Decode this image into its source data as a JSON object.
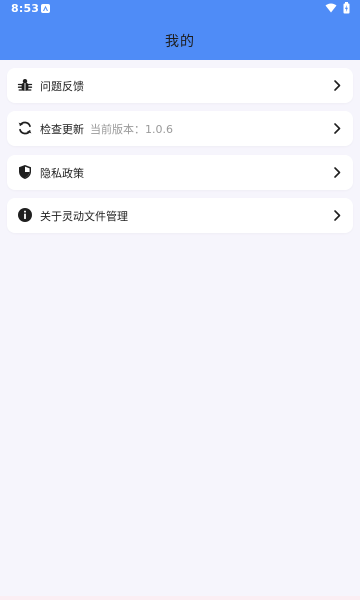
{
  "status_bar": {
    "time": "8:53"
  },
  "header": {
    "title": "我的"
  },
  "menu": {
    "items": [
      {
        "label": "问题反馈",
        "icon": "bug-icon"
      },
      {
        "label": "检查更新",
        "sub": "当前版本：1.0.6",
        "icon": "refresh-icon"
      },
      {
        "label": "隐私政策",
        "icon": "shield-icon"
      },
      {
        "label": "关于灵动文件管理",
        "icon": "info-icon"
      }
    ]
  },
  "colors": {
    "accent": "#4f8cf7",
    "background": "#f6f5fc"
  }
}
